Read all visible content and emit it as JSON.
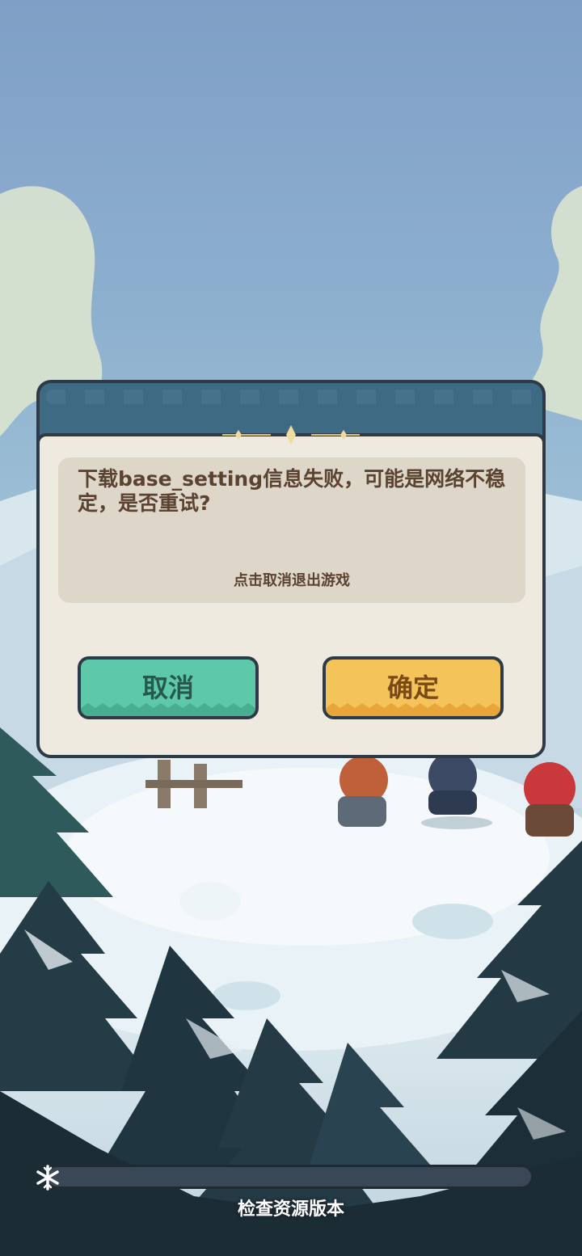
{
  "dialog": {
    "message": "下载base_setting信息失败，可能是网络不稳定，是否重试?",
    "hint": "点击取消退出游戏",
    "cancel_label": "取消",
    "confirm_label": "确定"
  },
  "loading": {
    "status_text": "检查资源版本",
    "progress": 0
  },
  "colors": {
    "cancel_button": "#5ec9a9",
    "confirm_button": "#f4c35a",
    "dialog_header": "#3f6a84",
    "dialog_body": "#efeadf",
    "message_text": "#5a4330"
  },
  "icons": {
    "loading_marker": "snowflake-icon"
  }
}
